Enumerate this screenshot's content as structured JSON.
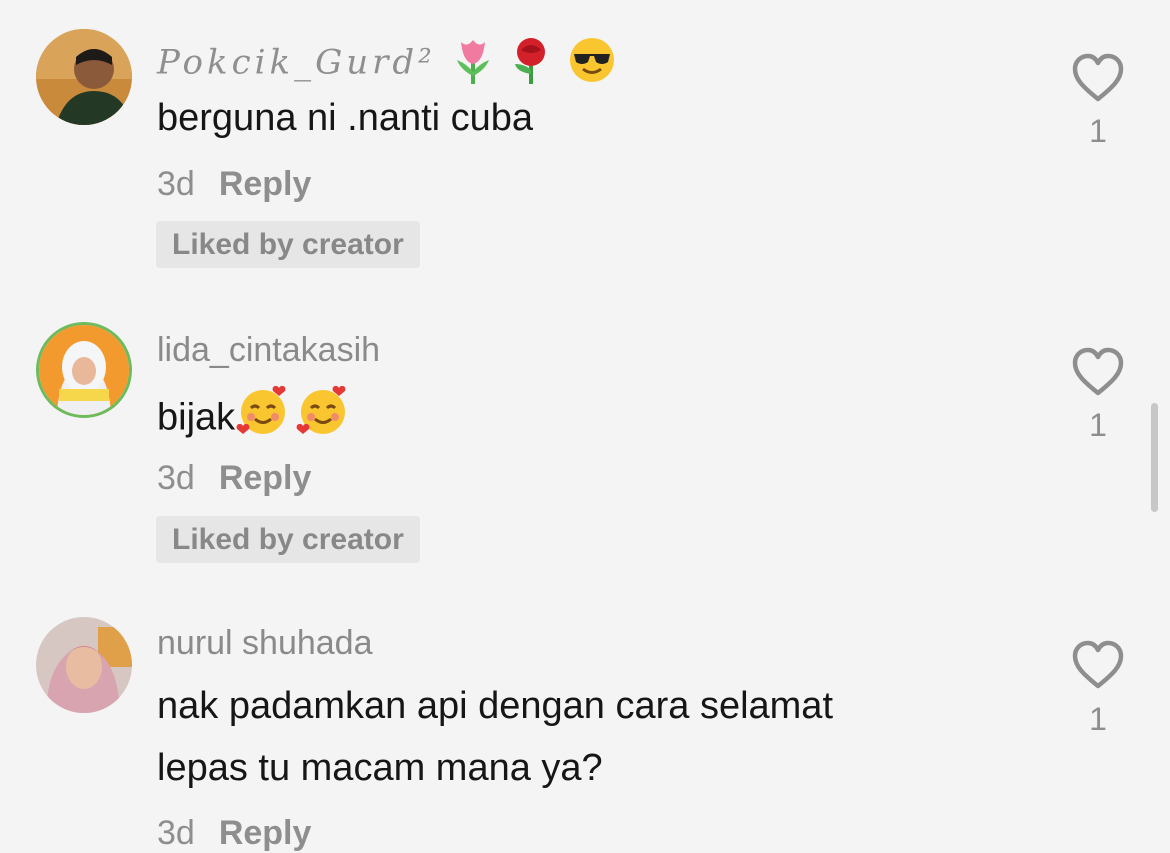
{
  "comments": [
    {
      "username": "Pokcik_Gurd²",
      "username_emojis": [
        "tulip-emoji",
        "rose-emoji",
        "sunglasses-emoji"
      ],
      "text": "berguna ni .nanti cuba",
      "time": "3d",
      "reply_label": "Reply",
      "badge": "Liked by creator",
      "likes": "1"
    },
    {
      "username": "lida_cintakasih",
      "text": "bijak",
      "text_emojis": [
        "smiling-face-with-hearts-emoji",
        "smiling-face-with-hearts-emoji"
      ],
      "time": "3d",
      "reply_label": "Reply",
      "badge": "Liked by creator",
      "likes": "1"
    },
    {
      "username": "nurul shuhada",
      "text_line1": "nak padamkan api dengan cara selamat",
      "text_line2": "lepas tu macam mana ya?",
      "time": "3d",
      "reply_label": "Reply",
      "likes": "1"
    }
  ],
  "colors": {
    "background": "#f4f4f4",
    "text": "#161616",
    "secondary": "#8e8e8e",
    "badge_bg": "#e6e6e6"
  }
}
